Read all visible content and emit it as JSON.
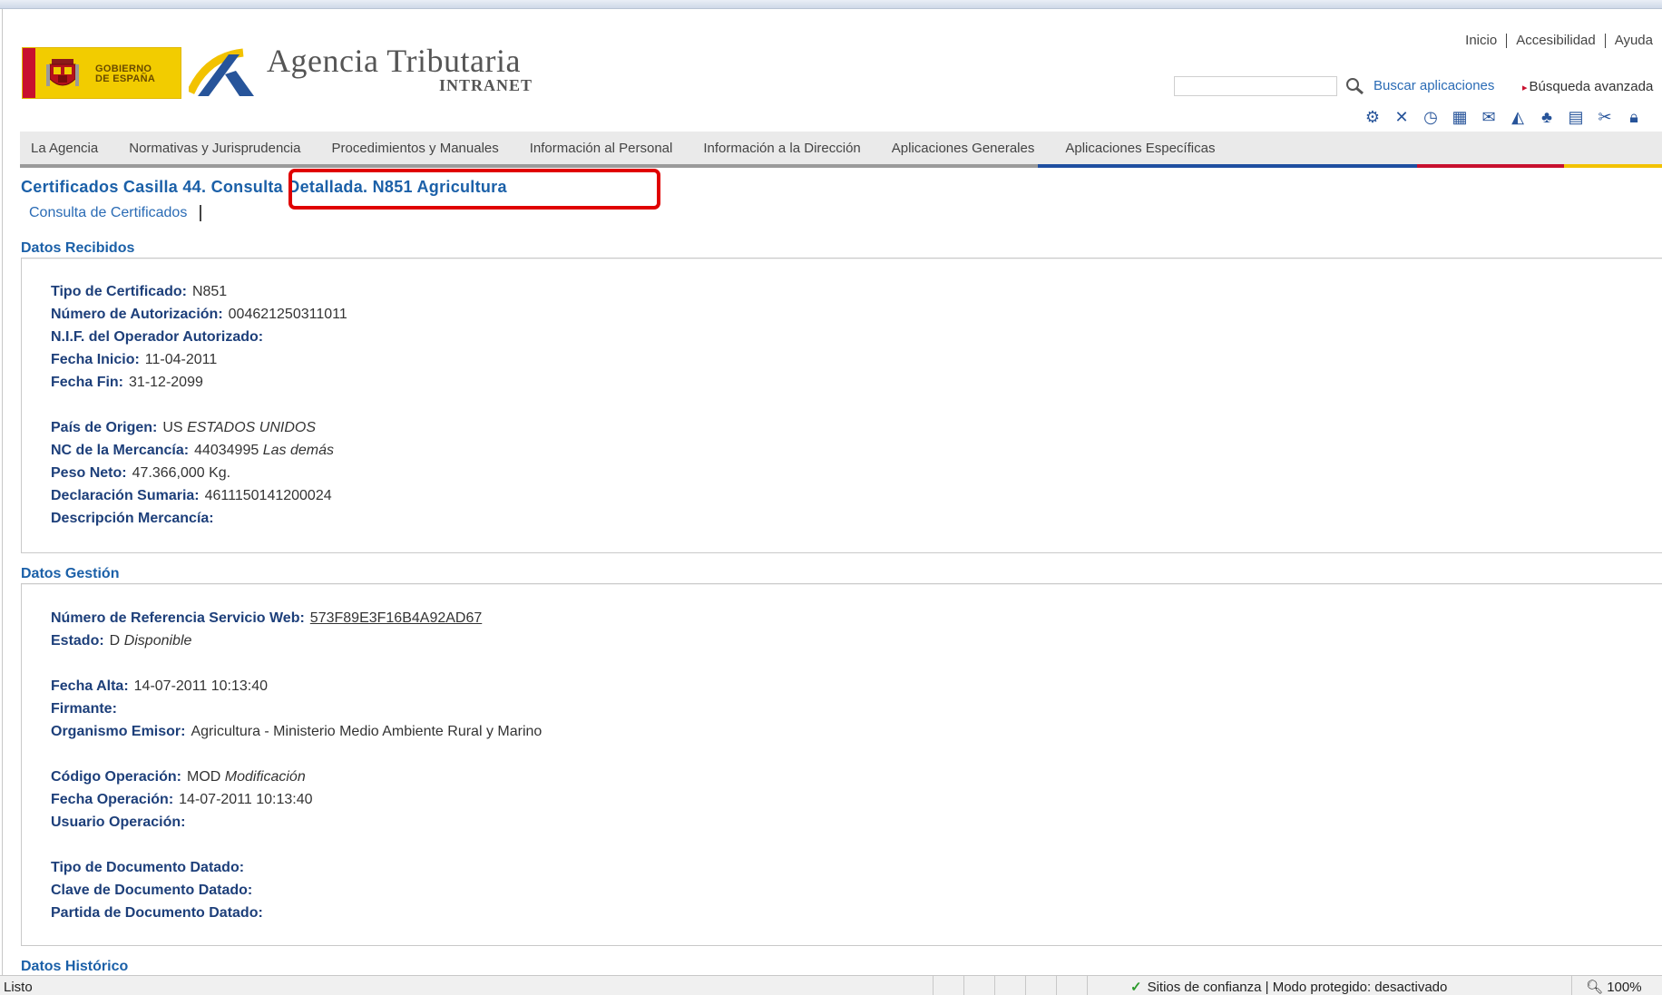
{
  "header": {
    "gobierno_line1": "GOBIERNO",
    "gobierno_line2": "DE ESPAÑA",
    "agency_title": "Agencia Tributaria",
    "agency_subtitle": "INTRANET",
    "links": {
      "inicio": "Inicio",
      "accesibilidad": "Accesibilidad",
      "ayuda": "Ayuda"
    },
    "search": {
      "value": "",
      "button_label": "Buscar aplicaciones",
      "advanced_label": "Búsqueda avanzada"
    },
    "toolbar_icons": [
      "settings-icon",
      "aeat-app-icon",
      "clock-icon",
      "grid-icon",
      "mail-icon",
      "aeat-app-icon-2",
      "tree-icon",
      "document-icon",
      "tools-icon",
      "lock-icon"
    ]
  },
  "nav": {
    "items": [
      "La Agencia",
      "Normativas y Jurisprudencia",
      "Procedimientos y Manuales",
      "Información al Personal",
      "Información a la Dirección",
      "Aplicaciones Generales",
      "Aplicaciones Específicas"
    ],
    "accent_colors": [
      "#1f4fa0",
      "#c8102e",
      "#f2c200"
    ]
  },
  "page": {
    "title": "Certificados Casilla 44. Consulta Detallada. N851 Agricultura",
    "breadcrumb": "Consulta de Certificados",
    "highlight_color": "#e00000"
  },
  "datos_recibidos": {
    "title": "Datos Recibidos",
    "tipo_certificado": {
      "label": "Tipo de Certificado:",
      "value": "N851"
    },
    "numero_autorizacion": {
      "label": "Número de Autorización:",
      "value": "004621250311011"
    },
    "nif_operador": {
      "label": "N.I.F. del Operador Autorizado:",
      "value": ""
    },
    "fecha_inicio": {
      "label": "Fecha Inicio:",
      "value": "11-04-2011"
    },
    "fecha_fin": {
      "label": "Fecha Fin:",
      "value": "31-12-2099"
    },
    "pais_origen": {
      "label": "País de Origen:",
      "code": "US",
      "name": "ESTADOS UNIDOS"
    },
    "nc_mercancia": {
      "label": "NC de la Mercancía:",
      "code": "44034995",
      "name": "Las demás"
    },
    "peso_neto": {
      "label": "Peso Neto:",
      "value": "47.366,000 Kg."
    },
    "declaracion_sumaria": {
      "label": "Declaración Sumaria:",
      "value": "4611150141200024"
    },
    "descripcion_mercancia": {
      "label": "Descripción Mercancía:",
      "value": ""
    }
  },
  "datos_gestion": {
    "title": "Datos Gestión",
    "numero_referencia": {
      "label": "Número de Referencia Servicio Web:",
      "value": "573F89E3F16B4A92AD67"
    },
    "estado": {
      "label": "Estado:",
      "code": "D",
      "name": "Disponible"
    },
    "fecha_alta": {
      "label": "Fecha Alta:",
      "value": "14-07-2011 10:13:40"
    },
    "firmante": {
      "label": "Firmante:",
      "value": ""
    },
    "organismo_emisor": {
      "label": "Organismo Emisor:",
      "value": "Agricultura - Ministerio Medio Ambiente Rural y Marino"
    },
    "codigo_operacion": {
      "label": "Código Operación:",
      "code": "MOD",
      "name": "Modificación"
    },
    "fecha_operacion": {
      "label": "Fecha Operación:",
      "value": "14-07-2011 10:13:40"
    },
    "usuario_operacion": {
      "label": "Usuario Operación:",
      "value": ""
    },
    "tipo_documento_datado": {
      "label": "Tipo de Documento Datado:",
      "value": ""
    },
    "clave_documento_datado": {
      "label": "Clave de Documento Datado:",
      "value": ""
    },
    "partida_documento_datado": {
      "label": "Partida de Documento Datado:",
      "value": ""
    }
  },
  "datos_historico": {
    "title": "Datos Histórico"
  },
  "statusbar": {
    "status": "Listo",
    "zone": "Sitios de confianza | Modo protegido: desactivado",
    "zoom": "100%"
  }
}
